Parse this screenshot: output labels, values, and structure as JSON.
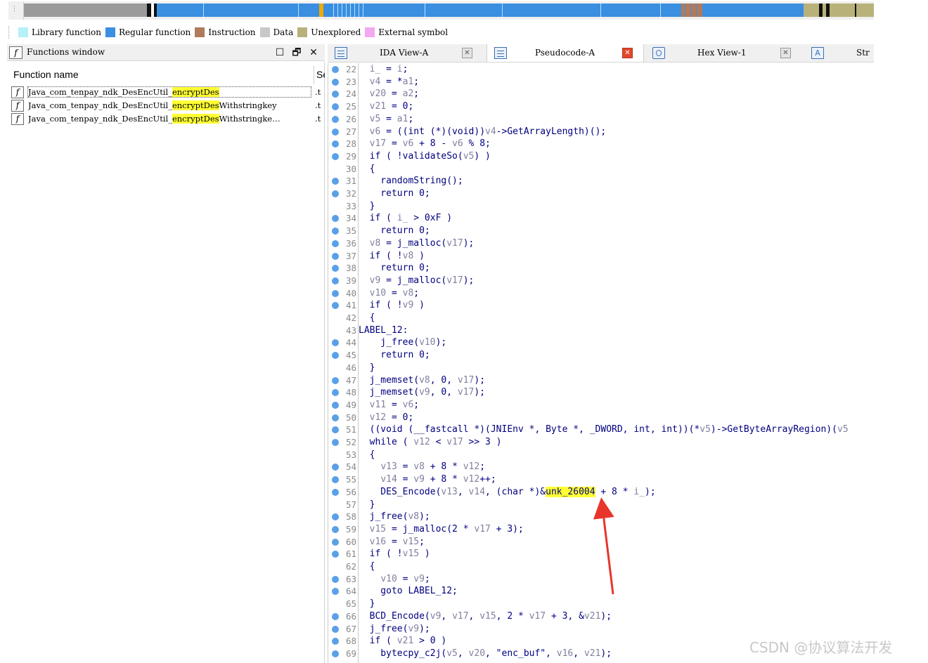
{
  "legend": [
    {
      "label": "Library function",
      "color": "#b6f0f8"
    },
    {
      "label": "Regular function",
      "color": "#3a8fe0"
    },
    {
      "label": "Instruction",
      "color": "#b07a5c"
    },
    {
      "label": "Data",
      "color": "#c8c8c8"
    },
    {
      "label": "Unexplored",
      "color": "#b8b27a"
    },
    {
      "label": "External symbol",
      "color": "#f4a8f0"
    }
  ],
  "functions_window": {
    "title": "Functions window",
    "column_name": "Function name",
    "column_segment": "Se",
    "rows": [
      {
        "prefix": "Java_com_tenpay_ndk_DesEncUtil_",
        "match": "encryptDes",
        "suffix": "",
        "segment": ".t"
      },
      {
        "prefix": "Java_com_tenpay_ndk_DesEncUtil_",
        "match": "encryptDes",
        "suffix": "Withstringkey",
        "segment": ".t"
      },
      {
        "prefix": "Java_com_tenpay_ndk_DesEncUtil_",
        "match": "encryptDes",
        "suffix": "Withstringke…",
        "segment": ".t"
      }
    ]
  },
  "tabs": [
    {
      "label": "IDA View-A",
      "icon": "ida-view-icon",
      "active": false
    },
    {
      "label": "Pseudocode-A",
      "icon": "pseudocode-icon",
      "active": true
    },
    {
      "label": "Hex View-1",
      "icon": "hex-view-icon",
      "active": false
    },
    {
      "label": "Str",
      "icon": "strings-icon",
      "active": false
    }
  ],
  "code": [
    {
      "n": "22",
      "bp": true,
      "t": "  i_ = i;"
    },
    {
      "n": "23",
      "bp": true,
      "t": "  v4 = *a1;"
    },
    {
      "n": "24",
      "bp": true,
      "t": "  v20 = a2;"
    },
    {
      "n": "25",
      "bp": true,
      "t": "  v21 = 0;"
    },
    {
      "n": "26",
      "bp": true,
      "t": "  v5 = a1;"
    },
    {
      "n": "27",
      "bp": true,
      "t": "  v6 = ((int (*)(void))v4->GetArrayLength)();"
    },
    {
      "n": "28",
      "bp": true,
      "t": "  v17 = v6 + 8 - v6 % 8;"
    },
    {
      "n": "29",
      "bp": true,
      "t": "  if ( !validateSo(v5) )"
    },
    {
      "n": "30",
      "bp": false,
      "t": "  {"
    },
    {
      "n": "31",
      "bp": true,
      "t": "    randomString();"
    },
    {
      "n": "32",
      "bp": true,
      "t": "    return 0;"
    },
    {
      "n": "33",
      "bp": false,
      "t": "  }"
    },
    {
      "n": "34",
      "bp": true,
      "t": "  if ( i_ > 0xF )"
    },
    {
      "n": "35",
      "bp": true,
      "t": "    return 0;"
    },
    {
      "n": "36",
      "bp": true,
      "t": "  v8 = j_malloc(v17);"
    },
    {
      "n": "37",
      "bp": true,
      "t": "  if ( !v8 )"
    },
    {
      "n": "38",
      "bp": true,
      "t": "    return 0;"
    },
    {
      "n": "39",
      "bp": true,
      "t": "  v9 = j_malloc(v17);"
    },
    {
      "n": "40",
      "bp": true,
      "t": "  v10 = v8;"
    },
    {
      "n": "41",
      "bp": true,
      "t": "  if ( !v9 )"
    },
    {
      "n": "42",
      "bp": false,
      "t": "  {"
    },
    {
      "n": "43",
      "bp": false,
      "t": "LABEL_12:"
    },
    {
      "n": "44",
      "bp": true,
      "t": "    j_free(v10);"
    },
    {
      "n": "45",
      "bp": true,
      "t": "    return 0;"
    },
    {
      "n": "46",
      "bp": false,
      "t": "  }"
    },
    {
      "n": "47",
      "bp": true,
      "t": "  j_memset(v8, 0, v17);"
    },
    {
      "n": "48",
      "bp": true,
      "t": "  j_memset(v9, 0, v17);"
    },
    {
      "n": "49",
      "bp": true,
      "t": "  v11 = v6;"
    },
    {
      "n": "50",
      "bp": true,
      "t": "  v12 = 0;"
    },
    {
      "n": "51",
      "bp": true,
      "t": "  ((void (__fastcall *)(JNIEnv *, Byte *, _DWORD, int, int))(*v5)->GetByteArrayRegion)(v5"
    },
    {
      "n": "52",
      "bp": true,
      "t": "  while ( v12 < v17 >> 3 )"
    },
    {
      "n": "53",
      "bp": false,
      "t": "  {"
    },
    {
      "n": "54",
      "bp": true,
      "t": "    v13 = v8 + 8 * v12;"
    },
    {
      "n": "55",
      "bp": true,
      "t": "    v14 = v9 + 8 * v12++;"
    },
    {
      "n": "56",
      "bp": true,
      "t": "    DES_Encode(v13, v14, (char *)&unk_26004 + 8 * i_);",
      "hl": "unk_26004"
    },
    {
      "n": "57",
      "bp": false,
      "t": "  }"
    },
    {
      "n": "58",
      "bp": true,
      "t": "  j_free(v8);"
    },
    {
      "n": "59",
      "bp": true,
      "t": "  v15 = j_malloc(2 * v17 + 3);"
    },
    {
      "n": "60",
      "bp": true,
      "t": "  v16 = v15;"
    },
    {
      "n": "61",
      "bp": true,
      "t": "  if ( !v15 )"
    },
    {
      "n": "62",
      "bp": false,
      "t": "  {"
    },
    {
      "n": "63",
      "bp": true,
      "t": "    v10 = v9;"
    },
    {
      "n": "64",
      "bp": true,
      "t": "    goto LABEL_12;"
    },
    {
      "n": "65",
      "bp": false,
      "t": "  }"
    },
    {
      "n": "66",
      "bp": true,
      "t": "  BCD_Encode(v9, v17, v15, 2 * v17 + 3, &v21);"
    },
    {
      "n": "67",
      "bp": true,
      "t": "  j_free(v9);"
    },
    {
      "n": "68",
      "bp": true,
      "t": "  if ( v21 > 0 )"
    },
    {
      "n": "69",
      "bp": true,
      "t": "    bytecpy_c2j(v5, v20, \"enc_buf\", v16, v21);"
    }
  ],
  "watermark": "CSDN @协议算法开发",
  "colors": {
    "highlight": "#ffff33",
    "arrow": "#e8352b",
    "breakpoint": "#5aa0e6",
    "code_text": "#000080",
    "variable": "#8080a0"
  }
}
